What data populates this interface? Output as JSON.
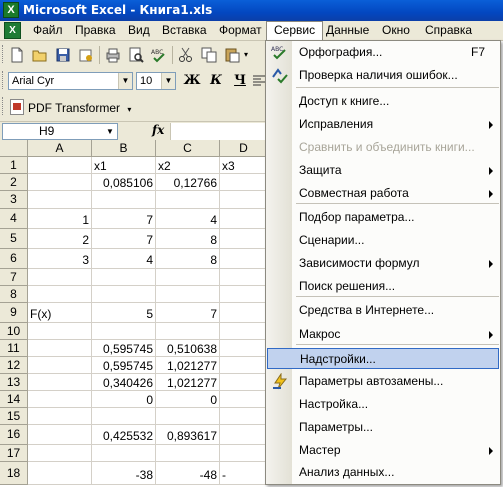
{
  "window": {
    "title": "Microsoft Excel - Книга1.xls"
  },
  "menubar": {
    "items": [
      "Файл",
      "Правка",
      "Вид",
      "Вставка",
      "Формат",
      "Сервис",
      "Данные",
      "Окно",
      "Справка"
    ],
    "active": "Сервис"
  },
  "format_toolbar": {
    "font": "Arial Cyr",
    "size": "10",
    "bold": "Ж",
    "italic": "К",
    "underline": "Ч"
  },
  "pdf_toolbar": {
    "label": "PDF Transformer"
  },
  "formula_bar": {
    "name_box": "H9",
    "fx": "fx",
    "value": ""
  },
  "sheet": {
    "columns": [
      "A",
      "B",
      "C",
      "D"
    ],
    "rows": [
      {
        "n": "1",
        "A": "",
        "B": "x1",
        "C": "x2",
        "D": "x3"
      },
      {
        "n": "2",
        "A": "",
        "B": "0,085106",
        "C": "0,12766",
        "D": ""
      },
      {
        "n": "3",
        "A": "",
        "B": "",
        "C": "",
        "D": ""
      },
      {
        "n": "4",
        "A": "1",
        "B": "7",
        "C": "4",
        "D": ""
      },
      {
        "n": "5",
        "A": "2",
        "B": "7",
        "C": "8",
        "D": ""
      },
      {
        "n": "6",
        "A": "3",
        "B": "4",
        "C": "8",
        "D": ""
      },
      {
        "n": "7",
        "A": "",
        "B": "",
        "C": "",
        "D": ""
      },
      {
        "n": "8",
        "A": "",
        "B": "",
        "C": "",
        "D": ""
      },
      {
        "n": "9",
        "A": "F(x)",
        "B": "5",
        "C": "7",
        "D": ""
      },
      {
        "n": "10",
        "A": "",
        "B": "",
        "C": "",
        "D": ""
      },
      {
        "n": "11",
        "A": "",
        "B": "0,595745",
        "C": "0,510638",
        "D": ""
      },
      {
        "n": "12",
        "A": "",
        "B": "0,595745",
        "C": "1,021277",
        "D": ""
      },
      {
        "n": "13",
        "A": "",
        "B": "0,340426",
        "C": "1,021277",
        "D": ""
      },
      {
        "n": "14",
        "A": "",
        "B": "0",
        "C": "0",
        "D": ""
      },
      {
        "n": "15",
        "A": "",
        "B": "",
        "C": "",
        "D": ""
      },
      {
        "n": "16",
        "A": "",
        "B": "0,425532",
        "C": "0,893617",
        "D": ""
      },
      {
        "n": "17",
        "A": "",
        "B": "",
        "C": "",
        "D": ""
      },
      {
        "n": "18",
        "A": "",
        "B": "-38",
        "C": "-48",
        "D": "-"
      }
    ]
  },
  "service_menu": {
    "items": [
      {
        "label": "Орфография...",
        "shortcut": "F7",
        "icon": "spelling-icon"
      },
      {
        "label": "Проверка наличия ошибок...",
        "icon": "error-check-icon"
      },
      {
        "label": "Доступ к книге..."
      },
      {
        "label": "Исправления",
        "submenu": true
      },
      {
        "label": "Сравнить и объединить книги...",
        "disabled": true
      },
      {
        "label": "Защита",
        "submenu": true
      },
      {
        "label": "Совместная работа",
        "submenu": true
      },
      {
        "label": "Подбор параметра..."
      },
      {
        "label": "Сценарии..."
      },
      {
        "label": "Зависимости формул",
        "submenu": true
      },
      {
        "label": "Поиск решения..."
      },
      {
        "label": "Средства в Интернете..."
      },
      {
        "label": "Макрос",
        "submenu": true
      },
      {
        "label": "Надстройки...",
        "highlighted": true
      },
      {
        "label": "Параметры автозамены...",
        "icon": "autocorrect-icon"
      },
      {
        "label": "Настройка..."
      },
      {
        "label": "Параметры..."
      },
      {
        "label": "Мастер",
        "submenu": true
      },
      {
        "label": "Анализ данных..."
      }
    ]
  },
  "colors": {
    "titlebar": "#0347c0",
    "menu_highlight": "#c1d2ee",
    "chrome": "#ece9d8"
  }
}
